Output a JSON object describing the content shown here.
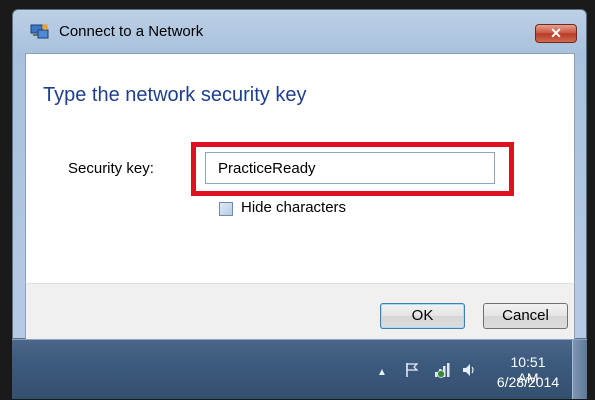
{
  "window": {
    "title": "Connect to a Network",
    "close_label": "✕"
  },
  "content": {
    "heading": "Type the network security key",
    "security_key_label": "Security key:",
    "security_key_value": "PracticeReady",
    "hide_characters_label": "Hide characters",
    "hide_characters_checked": false
  },
  "buttons": {
    "ok_label": "OK",
    "cancel_label": "Cancel"
  },
  "taskbar": {
    "time": "10:51 AM",
    "date": "6/28/2014",
    "tray_icons": [
      "show-hidden-icons",
      "action-center-flag-icon",
      "network-icon",
      "volume-icon"
    ]
  },
  "colors": {
    "heading": "#1e3f8f",
    "highlight_box": "#e01020",
    "close_button": "#c7513c",
    "taskbar": "#3c5a7e"
  }
}
